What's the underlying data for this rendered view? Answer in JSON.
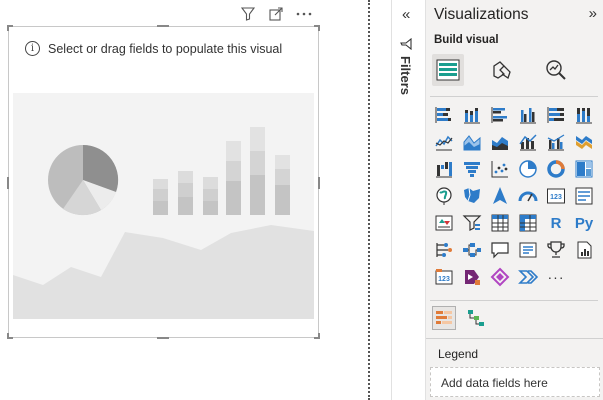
{
  "visual": {
    "hint_text": "Select or drag fields to populate this visual",
    "header_icons": [
      "filter-icon",
      "focus-mode-icon",
      "more-options-icon"
    ]
  },
  "filters": {
    "label": "Filters"
  },
  "visualizations": {
    "title": "Visualizations",
    "build_label": "Build visual",
    "modes": [
      "build-visual-icon",
      "format-visual-icon",
      "analytics-icon"
    ],
    "r_label": "R",
    "py_label": "Py",
    "more_label": "···",
    "legend_label": "Legend",
    "well_placeholder": "Add data fields here"
  },
  "colors": {
    "accent_blue": "#2e7cc9",
    "accent_teal": "#1a9e8f",
    "accent_orange": "#e07b39",
    "pane_bg": "#f3f2f1"
  }
}
